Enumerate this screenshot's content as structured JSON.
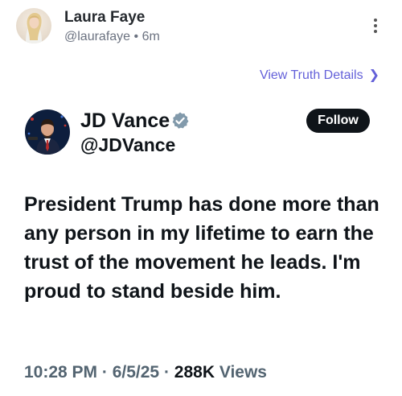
{
  "post": {
    "author_name": "Laura Faye",
    "author_handle": "@laurafaye",
    "separator": "•",
    "time_ago": "6m",
    "view_details_label": "View Truth Details"
  },
  "quoted": {
    "name": "JD Vance",
    "handle": "@JDVance",
    "follow_label": "Follow",
    "text": "President Trump has done more than any person in my lifetime to earn the trust of the movement he leads. I'm proud to stand beside him.",
    "time": "10:28 PM",
    "dot1": " · ",
    "date": "6/5/25",
    "dot2": " · ",
    "views_count": "288K",
    "views_label": " Views"
  },
  "colors": {
    "link": "#6461d9",
    "verified": "#829aab",
    "follow_bg": "#0f1419"
  },
  "icons": {
    "more": "more-vertical-icon",
    "chevron": "chevron-right-icon",
    "verified": "verified-badge-icon"
  }
}
